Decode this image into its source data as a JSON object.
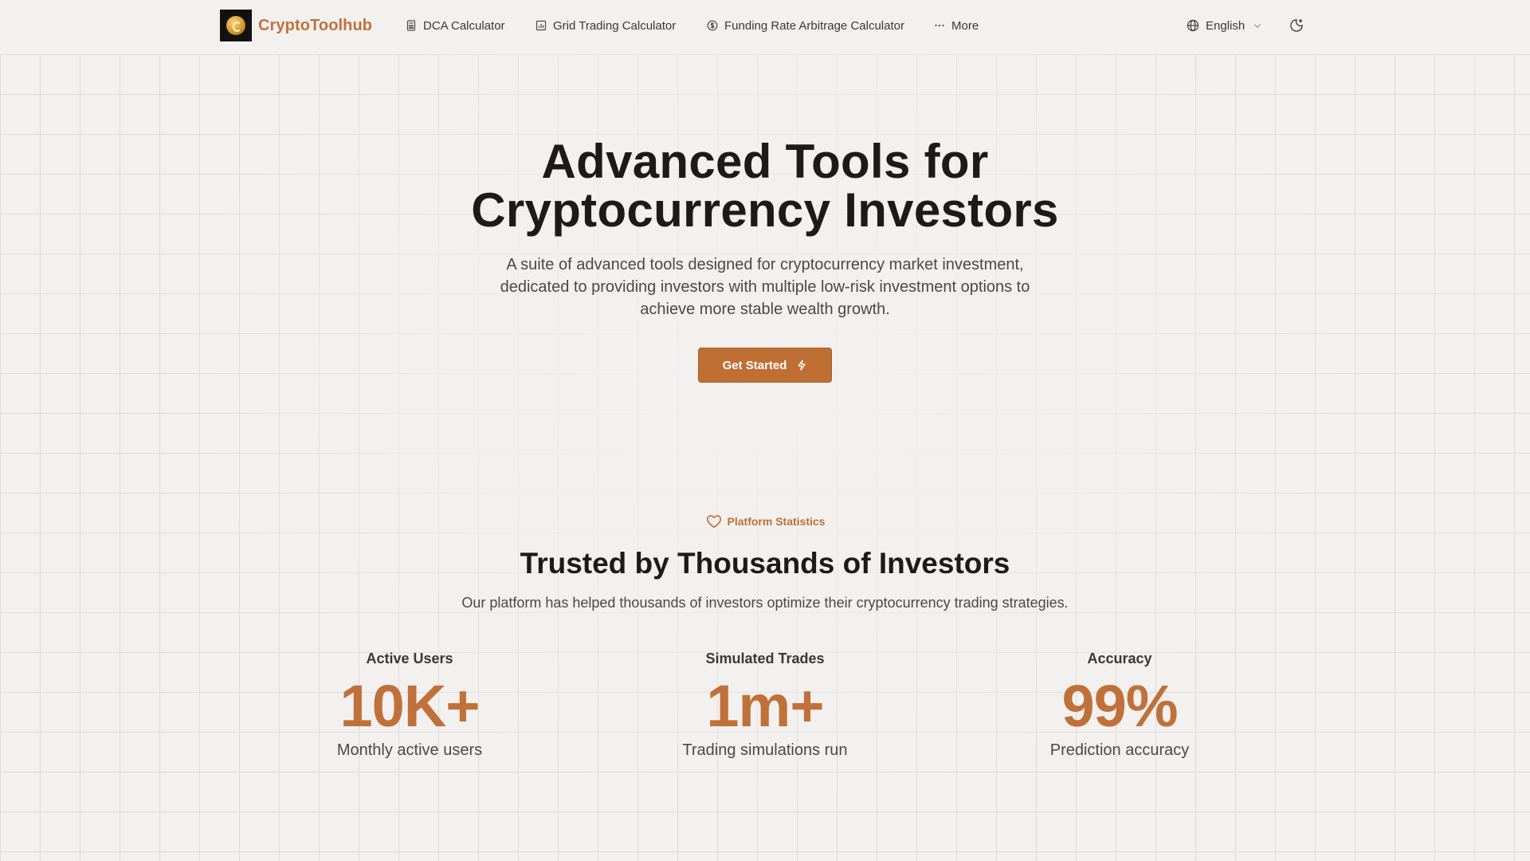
{
  "brand": {
    "name": "CryptoToolhub",
    "color": "#c0713a"
  },
  "nav": {
    "items": [
      {
        "label": "DCA Calculator",
        "icon": "calculator-icon"
      },
      {
        "label": "Grid Trading Calculator",
        "icon": "chart-icon"
      },
      {
        "label": "Funding Rate Arbitrage Calculator",
        "icon": "dollar-circle-icon"
      },
      {
        "label": "More",
        "icon": "ellipsis-icon"
      }
    ],
    "language": "English"
  },
  "hero": {
    "title_line1": "Advanced Tools for",
    "title_line2": "Cryptocurrency Investors",
    "subtitle_line1": "A suite of advanced tools designed for cryptocurrency market investment,",
    "subtitle_line2": "dedicated to providing investors with multiple low-risk investment options to",
    "subtitle_line3": "achieve more stable wealth growth.",
    "cta_label": "Get Started",
    "accent": "#bf6f33"
  },
  "stats": {
    "badge": "Platform Statistics",
    "title": "Trusted by Thousands of Investors",
    "subtitle": "Our platform has helped thousands of investors optimize their cryptocurrency trading strategies.",
    "items": [
      {
        "label": "Active Users",
        "value": "10K+",
        "desc": "Monthly active users"
      },
      {
        "label": "Simulated Trades",
        "value": "1m+",
        "desc": "Trading simulations run"
      },
      {
        "label": "Accuracy",
        "value": "99%",
        "desc": "Prediction accuracy"
      }
    ]
  }
}
